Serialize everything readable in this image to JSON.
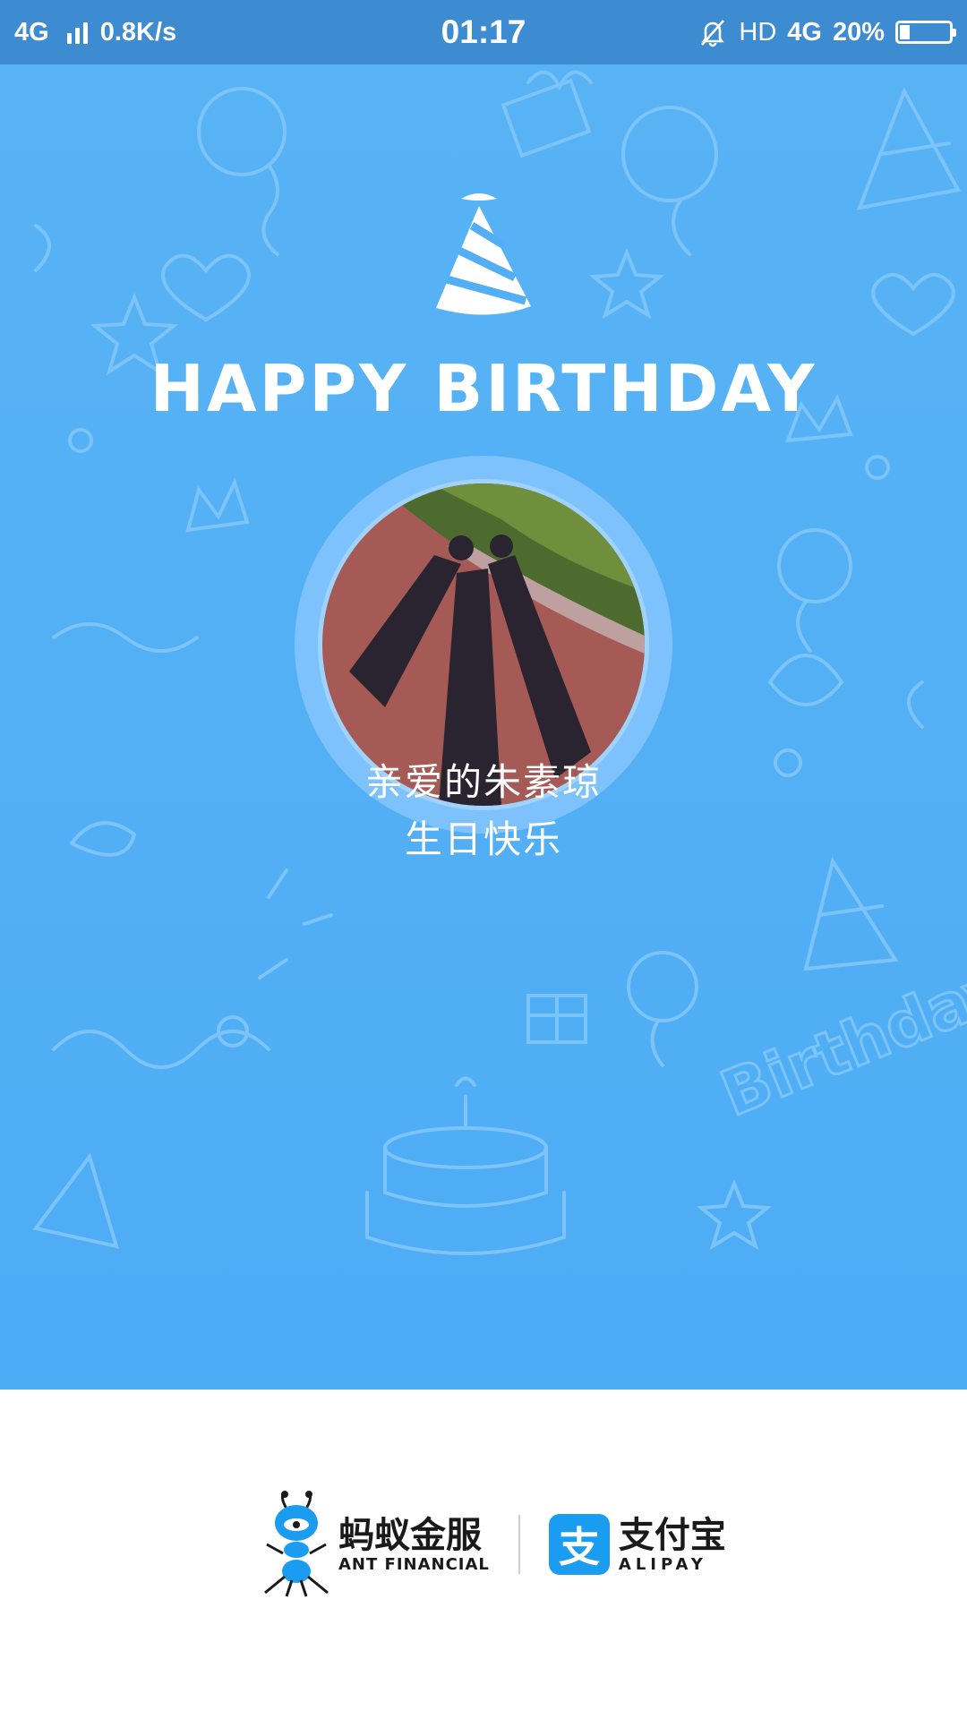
{
  "status_bar": {
    "network_type": "4G",
    "speed": "0.8K/s",
    "time": "01:17",
    "hd": "HD",
    "network_type_right": "4G",
    "battery_percent": "20%",
    "battery_level": 0.2,
    "icons": [
      "signal-icon",
      "mute-alarm-icon",
      "battery-icon"
    ]
  },
  "card": {
    "headline": "HAPPY BIRTHDAY",
    "greeting_line1": "亲爱的朱素琼",
    "greeting_line2": "生日快乐",
    "background_color": "#52aff5",
    "decor_icons": [
      "party-hat-icon",
      "balloon-icon",
      "gift-icon",
      "cake-icon",
      "heart-icon",
      "star-icon"
    ]
  },
  "footer": {
    "ant_name_cn": "蚂蚁金服",
    "ant_name_en": "ANT FINANCIAL",
    "alipay_glyph": "支",
    "alipay_name_cn": "支付宝",
    "alipay_name_en": "ALIPAY",
    "alipay_color": "#1a9df0"
  }
}
